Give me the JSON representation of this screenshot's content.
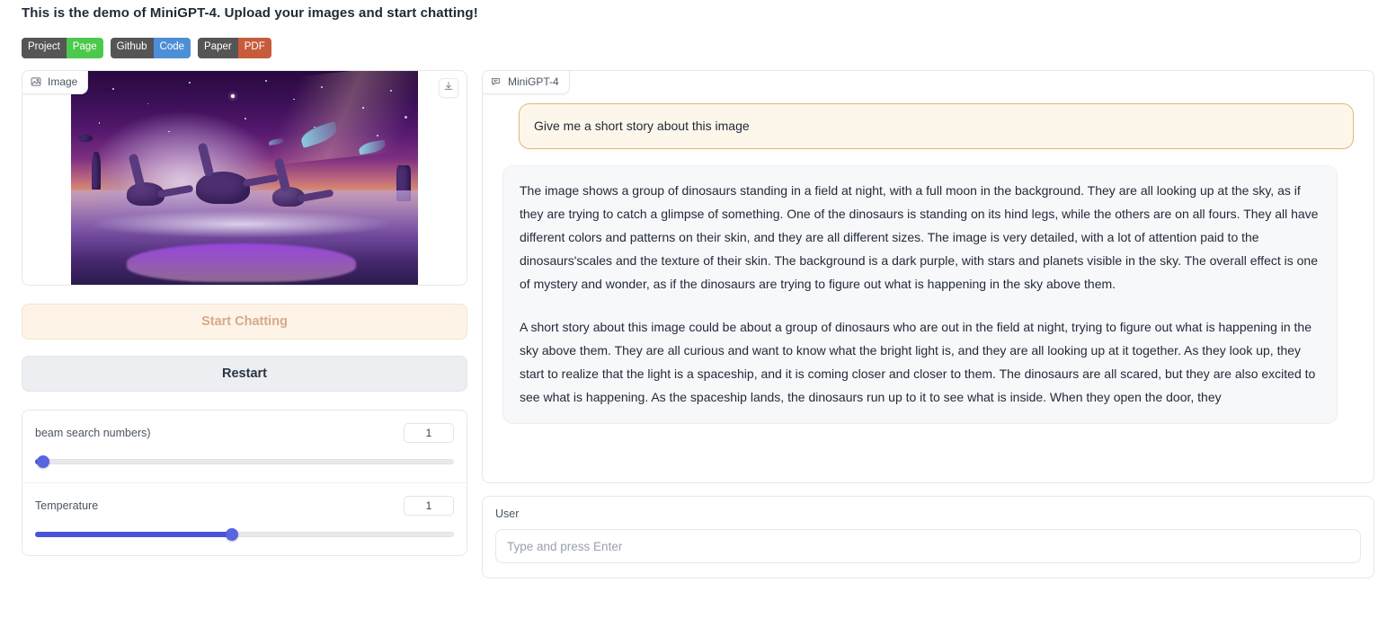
{
  "header": {
    "title": "This is the demo of MiniGPT-4. Upload your images and start chatting!",
    "badges": [
      {
        "left": "Project",
        "right": "Page",
        "right_color": "#4cc94c",
        "left_color": "#555555"
      },
      {
        "left": "Github",
        "right": "Code",
        "right_color": "#4d8fd6",
        "left_color": "#555555"
      },
      {
        "left": "Paper",
        "right": "PDF",
        "right_color": "#c75c3c",
        "left_color": "#555555"
      }
    ]
  },
  "left_panel": {
    "image_tab_label": "Image",
    "image_tab_icon": "image-icon",
    "download_icon": "download-icon",
    "image_alt": "Fantasy artwork of purple dinosaurs in a moonlit field with glowing creatures",
    "start_button": "Start Chatting",
    "restart_button": "Restart",
    "sliders": [
      {
        "label": "beam search numbers)",
        "value": "1",
        "percent": 2
      },
      {
        "label": "Temperature",
        "value": "1",
        "percent": 47
      }
    ]
  },
  "right_panel": {
    "chat_tab_label": "MiniGPT-4",
    "chat_tab_icon": "chat-bubble-icon",
    "user_message": "Give me a short story about this image",
    "bot_message_p1": "The image shows a group of dinosaurs standing in a field at night, with a full moon in the background. They are all looking up at the sky, as if they are trying to catch a glimpse of something. One of the dinosaurs is standing on its hind legs, while the others are on all fours. They all have different colors and patterns on their skin, and they are all different sizes. The image is very detailed, with a lot of attention paid to the dinosaurs'scales and the texture of their skin. The background is a dark purple, with stars and planets visible in the sky. The overall effect is one of mystery and wonder, as if the dinosaurs are trying to figure out what is happening in the sky above them.",
    "bot_message_p2": "A short story about this image could be about a group of dinosaurs who are out in the field at night, trying to figure out what is happening in the sky above them. They are all curious and want to know what the bright light is, and they are all looking up at it together. As they look up, they start to realize that the light is a spaceship, and it is coming closer and closer to them. The dinosaurs are all scared, but they are also excited to see what is happening. As the spaceship lands, the dinosaurs run up to it to see what is inside. When they open the door, they",
    "input_label": "User",
    "input_placeholder": "Type and press Enter",
    "input_value": ""
  },
  "colors": {
    "accent_slider": "#5864e0",
    "user_bubble_bg": "#fdf6ea",
    "user_bubble_border": "#e3b877",
    "bot_bubble_bg": "#f7f8fa",
    "start_button_bg": "#fdf4e7",
    "restart_button_bg": "#eceef2"
  }
}
